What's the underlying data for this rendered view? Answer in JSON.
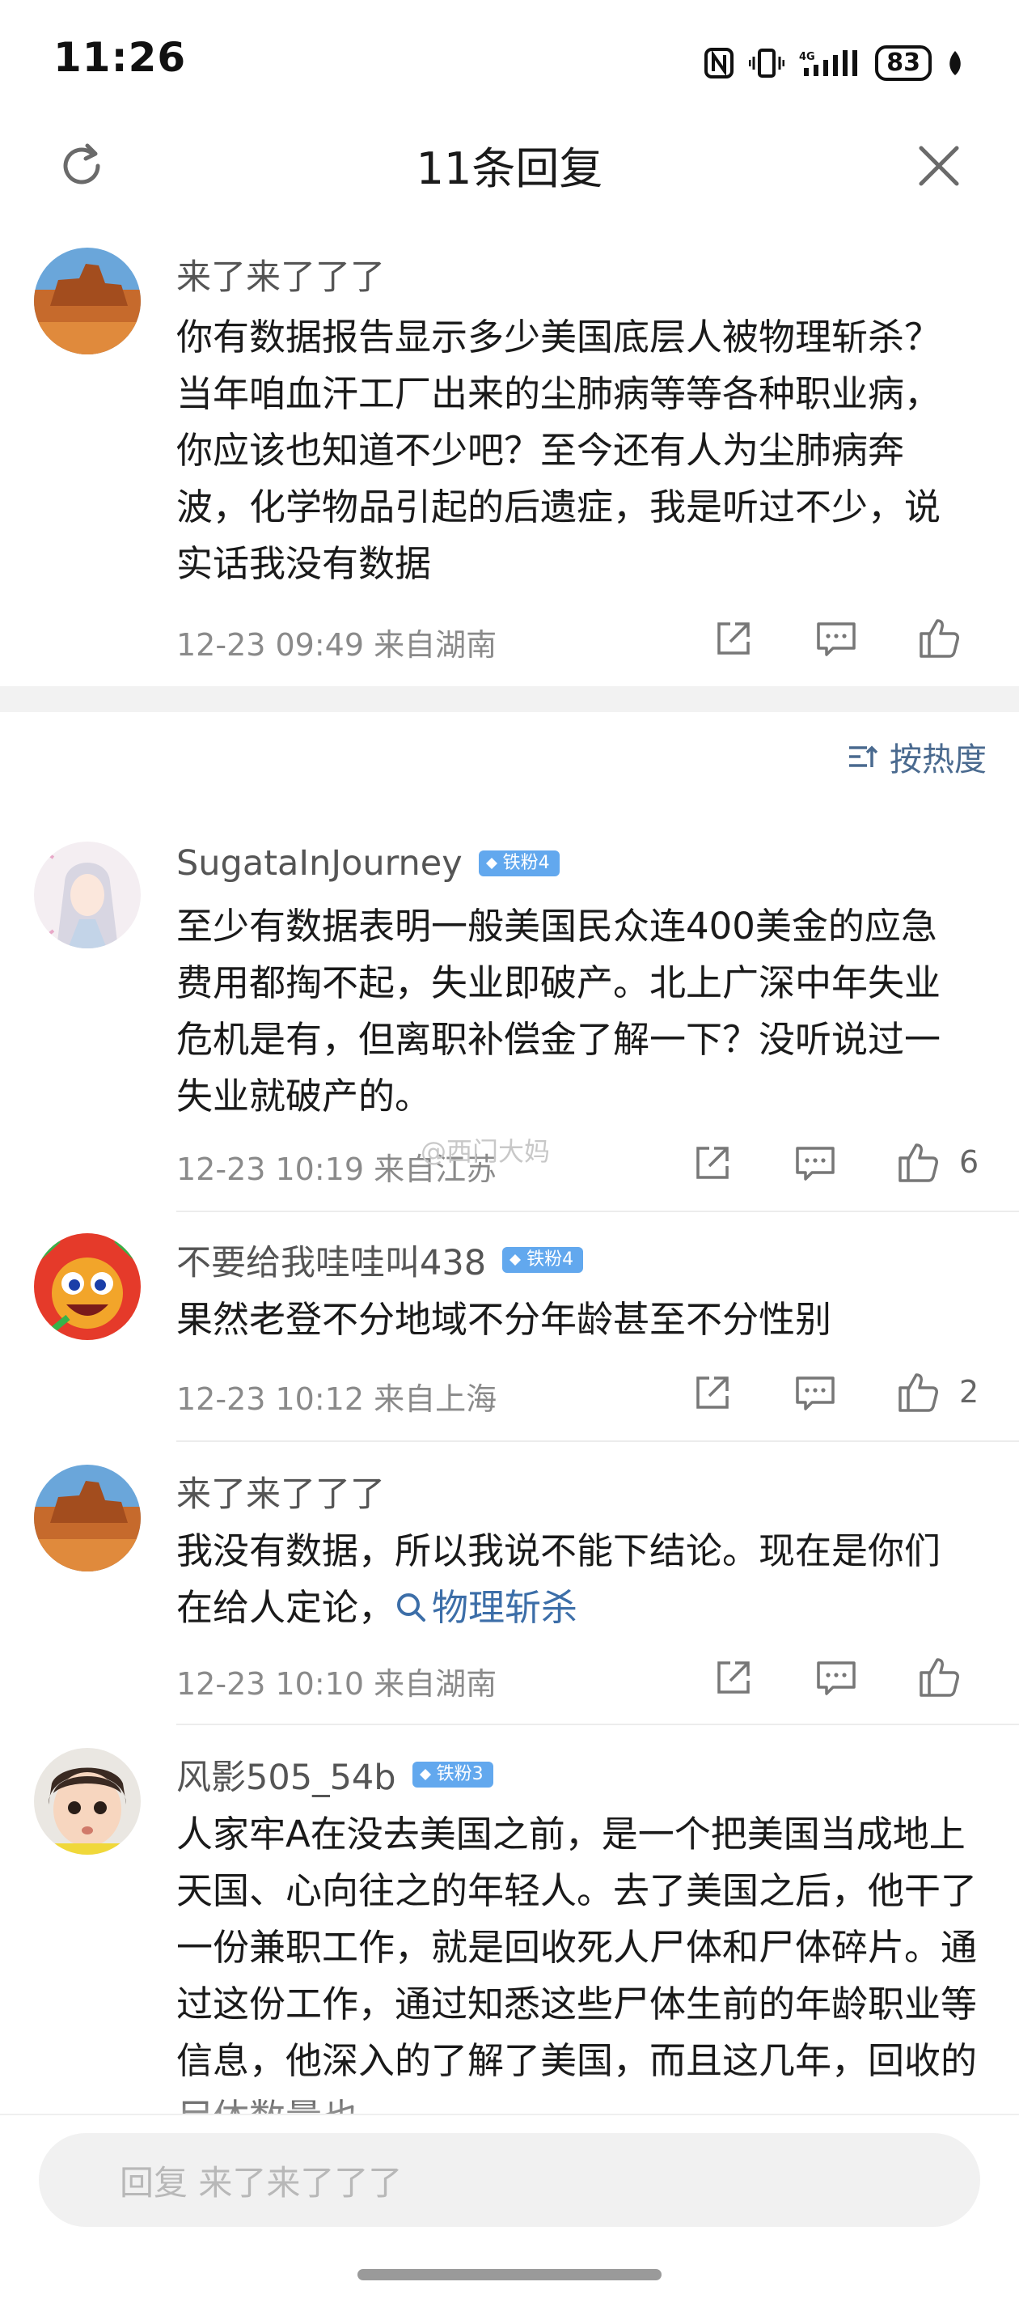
{
  "status_bar": {
    "time": "11:26",
    "battery": "83"
  },
  "header": {
    "title": "11条回复"
  },
  "root_comment": {
    "username": "来了来了了了",
    "text": "你有数据报告显示多少美国底层人被物理斩杀？当年咱血汗工厂出来的尘肺病等等各种职业病，你应该也知道不少吧？至今还有人为尘肺病奔波，化学物品引起的后遗症，我是听过不少，说实话我没有数据",
    "time": "12-23 09:49",
    "location": "来自湖南"
  },
  "sort": {
    "label": "按热度"
  },
  "replies": [
    {
      "username": "SugataInJourney",
      "badge": "铁粉4",
      "text": "至少有数据表明一般美国民众连400美金的应急费用都掏不起，失业即破产。北上广深中年失业危机是有，但离职补偿金了解一下？没听说过一失业就破产的。",
      "time": "12-23 10:19",
      "location": "来自江苏",
      "likes": "6"
    },
    {
      "username": "不要给我哇哇叫438",
      "badge": "铁粉4",
      "text": "果然老登不分地域不分年龄甚至不分性别",
      "time": "12-23 10:12",
      "location": "来自上海",
      "likes": "2"
    },
    {
      "username": "来了来了了了",
      "text": "我没有数据，所以我说不能下结论。现在是你们在给人定论，",
      "link": "物理斩杀",
      "time": "12-23 10:10",
      "location": "来自湖南"
    },
    {
      "username": "风影505_54b",
      "badge": "铁粉3",
      "text": "人家牢A在没去美国之前，是一个把美国当成地上天国、心向往之的年轻人。去了美国之后，他干了一份兼职工作，就是回收死人尸体和尸体碎片。通过这份工作，通过知悉这些尸体生前的年龄职业等信息，他深入的了解了美国，而且这几年，回收的尸体数量也"
    }
  ],
  "watermark": "@西门大妈",
  "reply_input": {
    "placeholder": "回复 来了来了了了"
  },
  "icons": {
    "refresh": "refresh-icon",
    "close": "close-icon",
    "share": "share-icon",
    "comment": "comment-icon",
    "like": "thumbs-up-icon",
    "sort": "sort-icon",
    "search": "search-icon",
    "diamond": "diamond-icon"
  },
  "colors": {
    "badge": "#62a8ee",
    "link": "#3c6ea8",
    "meta": "#8a8a8a"
  }
}
